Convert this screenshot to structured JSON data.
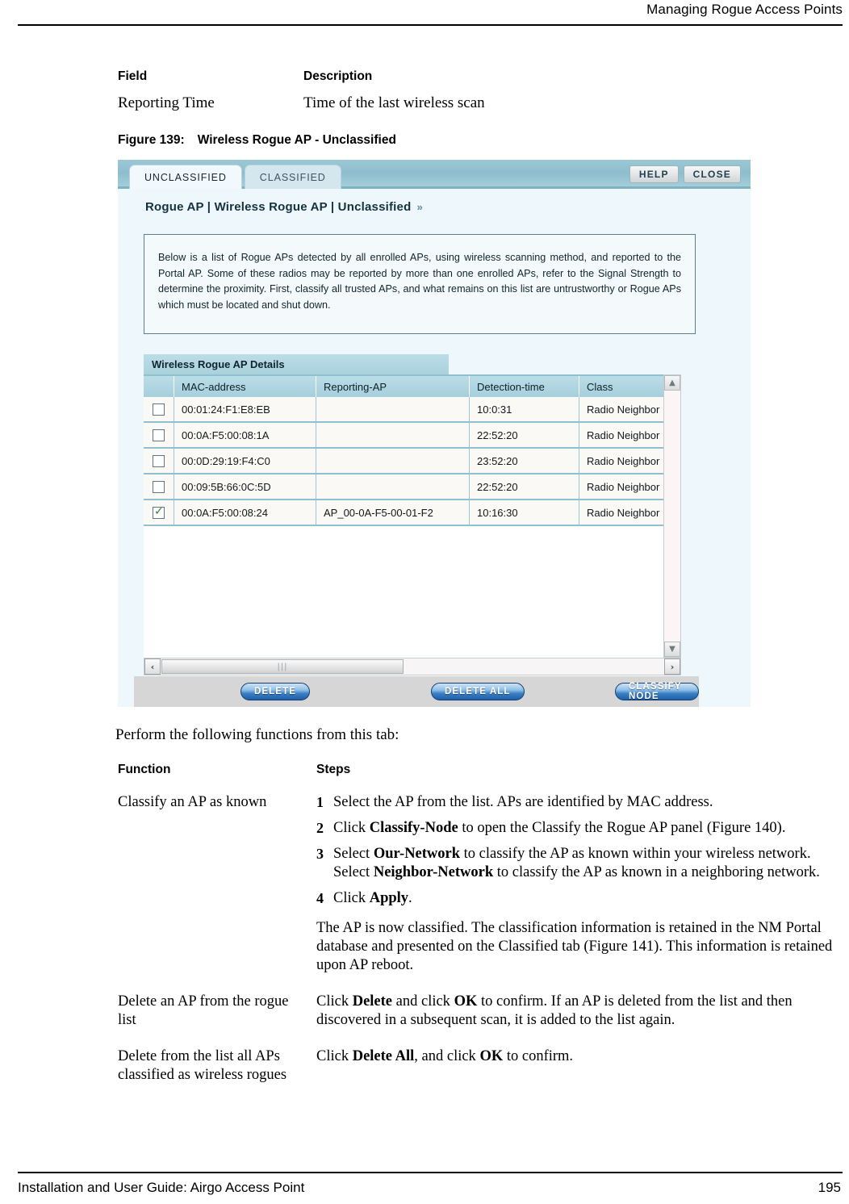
{
  "page": {
    "running_head": "Managing Rogue Access Points",
    "footer_left": "Installation and User Guide: Airgo Access Point",
    "footer_page_number": "195"
  },
  "field_table": {
    "headers": [
      "Field",
      "Description"
    ],
    "rows": [
      {
        "field": "Reporting Time",
        "description": "Time of the last wireless scan"
      }
    ]
  },
  "figure_caption": {
    "number": "Figure 139:",
    "title": "Wireless Rogue AP - Unclassified"
  },
  "screenshot": {
    "tabs": [
      {
        "label": "UNCLASSIFIED",
        "active": true
      },
      {
        "label": "CLASSIFIED",
        "active": false
      }
    ],
    "top_buttons": [
      {
        "label": "HELP"
      },
      {
        "label": "CLOSE"
      }
    ],
    "breadcrumb": "Rogue AP | Wireless Rogue AP | Unclassified",
    "breadcrumb_chevron": "»",
    "info_text": "Below is a list of Rogue APs detected by all enrolled APs, using wireless scanning method, and reported to the Portal AP. Some of these radios may be reported by more than one enrolled APs, refer to the Signal Strength to determine the proximity. First, classify all trusted APs, and what remains on this list are untrustworthy or Rogue APs which must be located and shut down.",
    "details_panel_title": "Wireless Rogue AP Details",
    "grid": {
      "columns": [
        "",
        "MAC-address",
        "Reporting-AP",
        "Detection-time",
        "Class"
      ],
      "rows": [
        {
          "checked": false,
          "mac": "00:01:24:F1:E8:EB",
          "reporting_ap": "",
          "detection_time": "10:0:31",
          "class": "Radio Neighbor"
        },
        {
          "checked": false,
          "mac": "00:0A:F5:00:08:1A",
          "reporting_ap": "",
          "detection_time": "22:52:20",
          "class": "Radio Neighbor"
        },
        {
          "checked": false,
          "mac": "00:0D:29:19:F4:C0",
          "reporting_ap": "",
          "detection_time": "23:52:20",
          "class": "Radio Neighbor"
        },
        {
          "checked": false,
          "mac": "00:09:5B:66:0C:5D",
          "reporting_ap": "",
          "detection_time": "22:52:20",
          "class": "Radio Neighbor"
        },
        {
          "checked": true,
          "mac": "00:0A:F5:00:08:24",
          "reporting_ap": "AP_00-0A-F5-00-01-F2",
          "detection_time": "10:16:30",
          "class": "Radio Neighbor"
        }
      ]
    },
    "scroll": {
      "up_arrow": "▲",
      "down_arrow": "▼",
      "left_arrow": "‹",
      "right_arrow": "›",
      "thumb_grip": "|||"
    },
    "action_buttons": [
      {
        "label": "DELETE"
      },
      {
        "label": "DELETE ALL"
      },
      {
        "label": "CLASSIFY NODE"
      }
    ]
  },
  "perform_line": "Perform the following functions from this tab:",
  "function_table": {
    "headers": [
      "Function",
      "Steps"
    ],
    "rows": [
      {
        "function": "Classify an AP as known",
        "steps": [
          {
            "num": "1",
            "text_a": "Select the AP from the list. APs are identified by MAC address.",
            "bold": "",
            "text_b": ""
          },
          {
            "num": "2",
            "text_a": "Click ",
            "bold": "Classify-Node",
            "text_b": " to open the Classify the Rogue AP panel (Figure 140)."
          },
          {
            "num": "3",
            "text_a": "Select ",
            "bold": "Our-Network",
            "text_b": " to classify the AP as known within your wireless network. Select ",
            "bold2": "Neighbor-Network",
            "text_c": " to classify the AP as known in a neighboring network."
          },
          {
            "num": "4",
            "text_a": "Click ",
            "bold": "Apply",
            "text_b": "."
          }
        ],
        "note": "The AP is now classified. The classification information is retained in the NM Portal database and presented on the Classified tab (Figure 141). This information is retained upon AP reboot."
      },
      {
        "function": "Delete an AP from the rogue list",
        "plain_a": "Click ",
        "bold_a": "Delete",
        "plain_b": " and click ",
        "bold_b": "OK",
        "plain_c": " to confirm. If an AP is deleted from the list and then discovered in a subsequent scan, it is added to the list again."
      },
      {
        "function": "Delete from the list all APs classified as wireless rogues",
        "plain_a": "Click ",
        "bold_a": "Delete All",
        "plain_b": ", and click ",
        "bold_b": "OK",
        "plain_c": " to confirm."
      }
    ]
  }
}
